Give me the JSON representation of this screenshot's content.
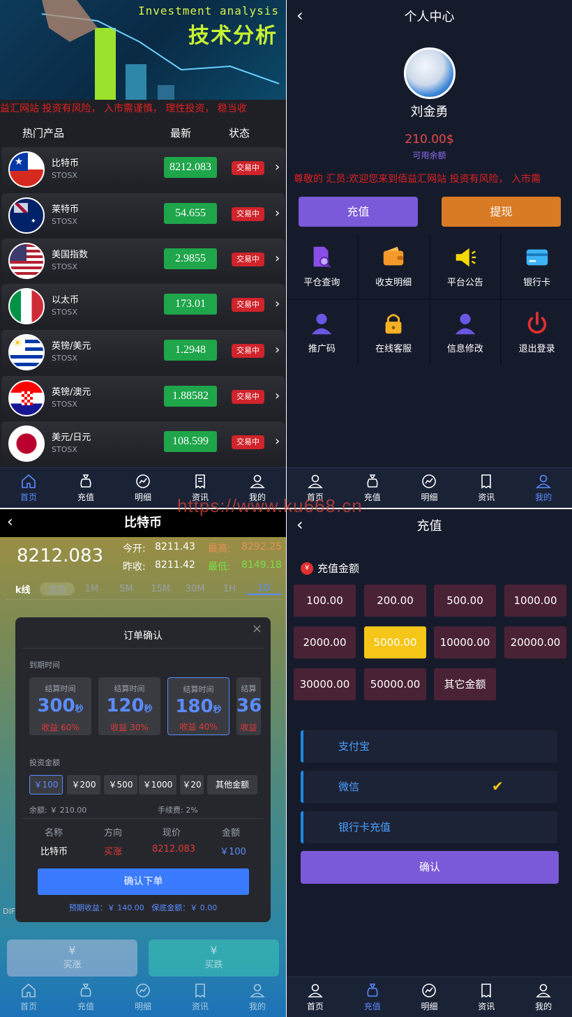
{
  "market": {
    "banner_en": "Investment analysis",
    "banner_cn": "技术分析",
    "marquee": "益汇网站 投资有风险， 入市需谨慎， 理性投资， 稳当收",
    "headers": {
      "product": "热门产品",
      "latest": "最新",
      "status": "状态"
    },
    "rows": [
      {
        "name": "比特币",
        "code": "STOSX",
        "price": "8212.083",
        "status": "交易中"
      },
      {
        "name": "莱特币",
        "code": "STOSX",
        "price": "54.655",
        "status": "交易中"
      },
      {
        "name": "美国指数",
        "code": "STOSX",
        "price": "2.9855",
        "status": "交易中"
      },
      {
        "name": "以太币",
        "code": "STOSX",
        "price": "173.01",
        "status": "交易中"
      },
      {
        "name": "英镑/美元",
        "code": "STOSX",
        "price": "1.2948",
        "status": "交易中"
      },
      {
        "name": "英镑/澳元",
        "code": "STOSX",
        "price": "1.88582",
        "status": "交易中"
      },
      {
        "name": "美元/日元",
        "code": "STOSX",
        "price": "108.599",
        "status": "交易中"
      }
    ]
  },
  "tabs": [
    "首页",
    "充值",
    "明细",
    "资讯",
    "我的"
  ],
  "profile": {
    "title": "个人中心",
    "username": "刘金勇",
    "balance": "210.00$",
    "balance_label": "可用余额",
    "marquee": "尊敬的 汇员:欢迎您来到佰益汇网站 投资有风险， 入市需",
    "recharge": "充值",
    "withdraw": "提现",
    "menu": [
      "平仓查询",
      "收支明细",
      "平台公告",
      "银行卡",
      "推广码",
      "在线客服",
      "信息修改",
      "退出登录"
    ]
  },
  "trade": {
    "title": "比特币",
    "price": "8212.083",
    "open_label": "今开:",
    "open": "8211.43",
    "high_label": "最高:",
    "high": "8292.25",
    "prev_label": "昨收:",
    "prev": "8211.42",
    "low_label": "最低:",
    "low": "8149.18",
    "ktabs": [
      "k线",
      "走势",
      "1M",
      "5M",
      "15M",
      "30M",
      "1H",
      "1D"
    ],
    "modal": {
      "title": "订单确认",
      "expire_label": "到期时间",
      "cards": [
        {
          "label": "结算时间",
          "value": "300",
          "unit": "秒",
          "profit": "收益 60%"
        },
        {
          "label": "结算时间",
          "value": "120",
          "unit": "秒",
          "profit": "收益 30%"
        },
        {
          "label": "结算时间",
          "value": "180",
          "unit": "秒",
          "profit": "收益 40%"
        },
        {
          "label": "结算",
          "value": "36",
          "unit": "",
          "profit": "收益"
        }
      ],
      "amount_label": "投资金额",
      "amounts": [
        "￥100",
        "￥200",
        "￥500",
        "￥1000",
        "￥20",
        "其他金额"
      ],
      "balance": "余额: ￥ 210.00",
      "fee": "手续费: 2%",
      "col_heads": [
        "名称",
        "方向",
        "现价",
        "金额"
      ],
      "col_vals": [
        "比特币",
        "买涨",
        "8212.083",
        "￥100"
      ],
      "confirm": "确认下单",
      "footer": "预期收益：￥ 140.00   保底金额：￥ 0.00"
    },
    "buy_up": "买涨",
    "buy_down": "买跌",
    "side_text": "DIF"
  },
  "recharge": {
    "title": "充值",
    "amount_label": "充值金额",
    "amounts": [
      "100.00",
      "200.00",
      "500.00",
      "1000.00",
      "2000.00",
      "5000.00",
      "10000.00",
      "20000.00",
      "30000.00",
      "50000.00",
      "其它金额"
    ],
    "selected_index": 5,
    "methods": [
      "支付宝",
      "微信",
      "银行卡充值"
    ],
    "confirm": "确认"
  },
  "watermark": "https://www.ku668.cn"
}
